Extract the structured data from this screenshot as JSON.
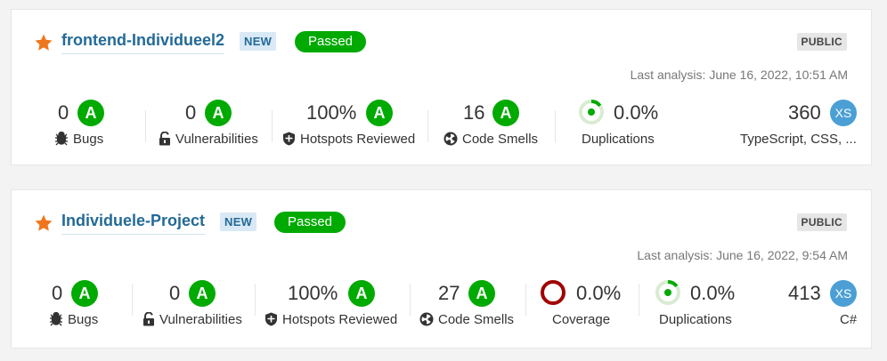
{
  "projects": [
    {
      "name": "frontend-Individueel2",
      "new_label": "NEW",
      "status": "Passed",
      "visibility": "PUBLIC",
      "last_analysis": "Last analysis: June 16, 2022, 10:51 AM",
      "bugs": {
        "value": "0",
        "rating": "A",
        "label": "Bugs"
      },
      "vulnerabilities": {
        "value": "0",
        "rating": "A",
        "label": "Vulnerabilities"
      },
      "hotspots": {
        "value": "100%",
        "rating": "A",
        "label": "Hotspots Reviewed"
      },
      "code_smells": {
        "value": "16",
        "rating": "A",
        "label": "Code Smells"
      },
      "duplications": {
        "value": "0.0%",
        "label": "Duplications",
        "fraction": 0.15
      },
      "size": {
        "value": "360",
        "badge": "XS",
        "languages": "TypeScript, CSS, ..."
      }
    },
    {
      "name": "Individuele-Project",
      "new_label": "NEW",
      "status": "Passed",
      "visibility": "PUBLIC",
      "last_analysis": "Last analysis: June 16, 2022, 9:54 AM",
      "bugs": {
        "value": "0",
        "rating": "A",
        "label": "Bugs"
      },
      "vulnerabilities": {
        "value": "0",
        "rating": "A",
        "label": "Vulnerabilities"
      },
      "hotspots": {
        "value": "100%",
        "rating": "A",
        "label": "Hotspots Reviewed"
      },
      "code_smells": {
        "value": "27",
        "rating": "A",
        "label": "Code Smells"
      },
      "coverage": {
        "value": "0.0%",
        "label": "Coverage"
      },
      "duplications": {
        "value": "0.0%",
        "label": "Duplications",
        "fraction": 0.15
      },
      "size": {
        "value": "413",
        "badge": "XS",
        "languages": "C#"
      }
    }
  ],
  "colors": {
    "link": "#236a97",
    "passed": "#00aa00",
    "rating_a": "#00aa00",
    "coverage_fail": "#a00000",
    "size_badge": "#4b9fd5",
    "star": "#f0761c"
  }
}
